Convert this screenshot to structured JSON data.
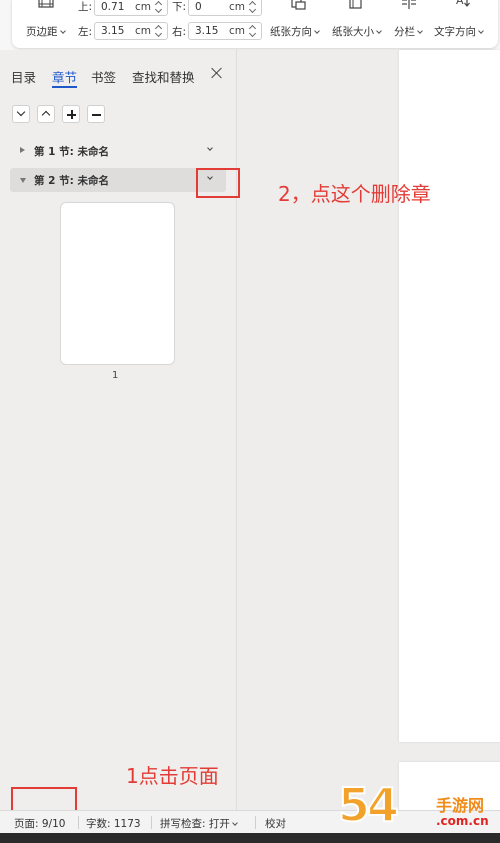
{
  "ribbon": {
    "margins_label": "页边距",
    "top_label": "上:",
    "top_value": "0.71",
    "bottom_label": "下:",
    "bottom_value": "0",
    "left_label": "左:",
    "left_value": "3.15",
    "right_label": "右:",
    "right_value": "3.15",
    "unit": "cm",
    "orientation_label": "纸张方向",
    "size_label": "纸张大小",
    "columns_label": "分栏",
    "text_direction_label": "文字方向"
  },
  "nav": {
    "tabs": [
      {
        "label": "目录"
      },
      {
        "label": "章节"
      },
      {
        "label": "书签"
      },
      {
        "label": "查找和替换"
      }
    ],
    "active_tab": "章节",
    "sections": [
      {
        "label": "第 1 节: 未命名",
        "expanded": false
      },
      {
        "label": "第 2 节: 未命名",
        "expanded": true
      }
    ],
    "thumbnail_number": "1"
  },
  "annotations": {
    "step2": "2，点这个删除章",
    "step1": "1点击页面"
  },
  "status": {
    "page": "页面: 9/10",
    "words": "字数: 1173",
    "spell": "拼写检查: 打开",
    "proof": "校对"
  },
  "watermark": {
    "number": "54",
    "title": "手游网",
    "url": ".com.cn"
  },
  "colors": {
    "accent": "#1f58c9",
    "annotation": "#e33c36",
    "watermark_orange": "#f2a12a"
  }
}
